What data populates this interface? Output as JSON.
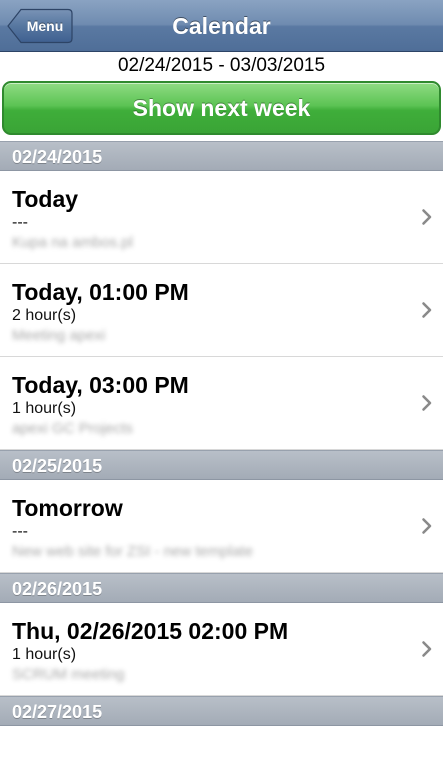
{
  "navbar": {
    "back_label": "Menu",
    "title": "Calendar"
  },
  "date_range": "02/24/2015 - 03/03/2015",
  "next_week_label": "Show next week",
  "sections": [
    {
      "date": "02/24/2015",
      "events": [
        {
          "title": "Today",
          "duration": "---",
          "description": "Kupa na ambos.pl"
        },
        {
          "title": "Today, 01:00 PM",
          "duration": "2 hour(s)",
          "description": "Meeting apexi"
        },
        {
          "title": "Today, 03:00 PM",
          "duration": "1 hour(s)",
          "description": "apexi GC Projects"
        }
      ]
    },
    {
      "date": "02/25/2015",
      "events": [
        {
          "title": "Tomorrow",
          "duration": "---",
          "description": "New web site for ZSI - new template"
        }
      ]
    },
    {
      "date": "02/26/2015",
      "events": [
        {
          "title": "Thu, 02/26/2015 02:00 PM",
          "duration": "1 hour(s)",
          "description": "SCRUM meeting"
        }
      ]
    },
    {
      "date": "02/27/2015",
      "events": []
    }
  ],
  "colors": {
    "navbar": "#5a79a2",
    "button_green": "#4cb946",
    "section_header": "#a9b0ba",
    "chevron": "#8a8a8a"
  }
}
